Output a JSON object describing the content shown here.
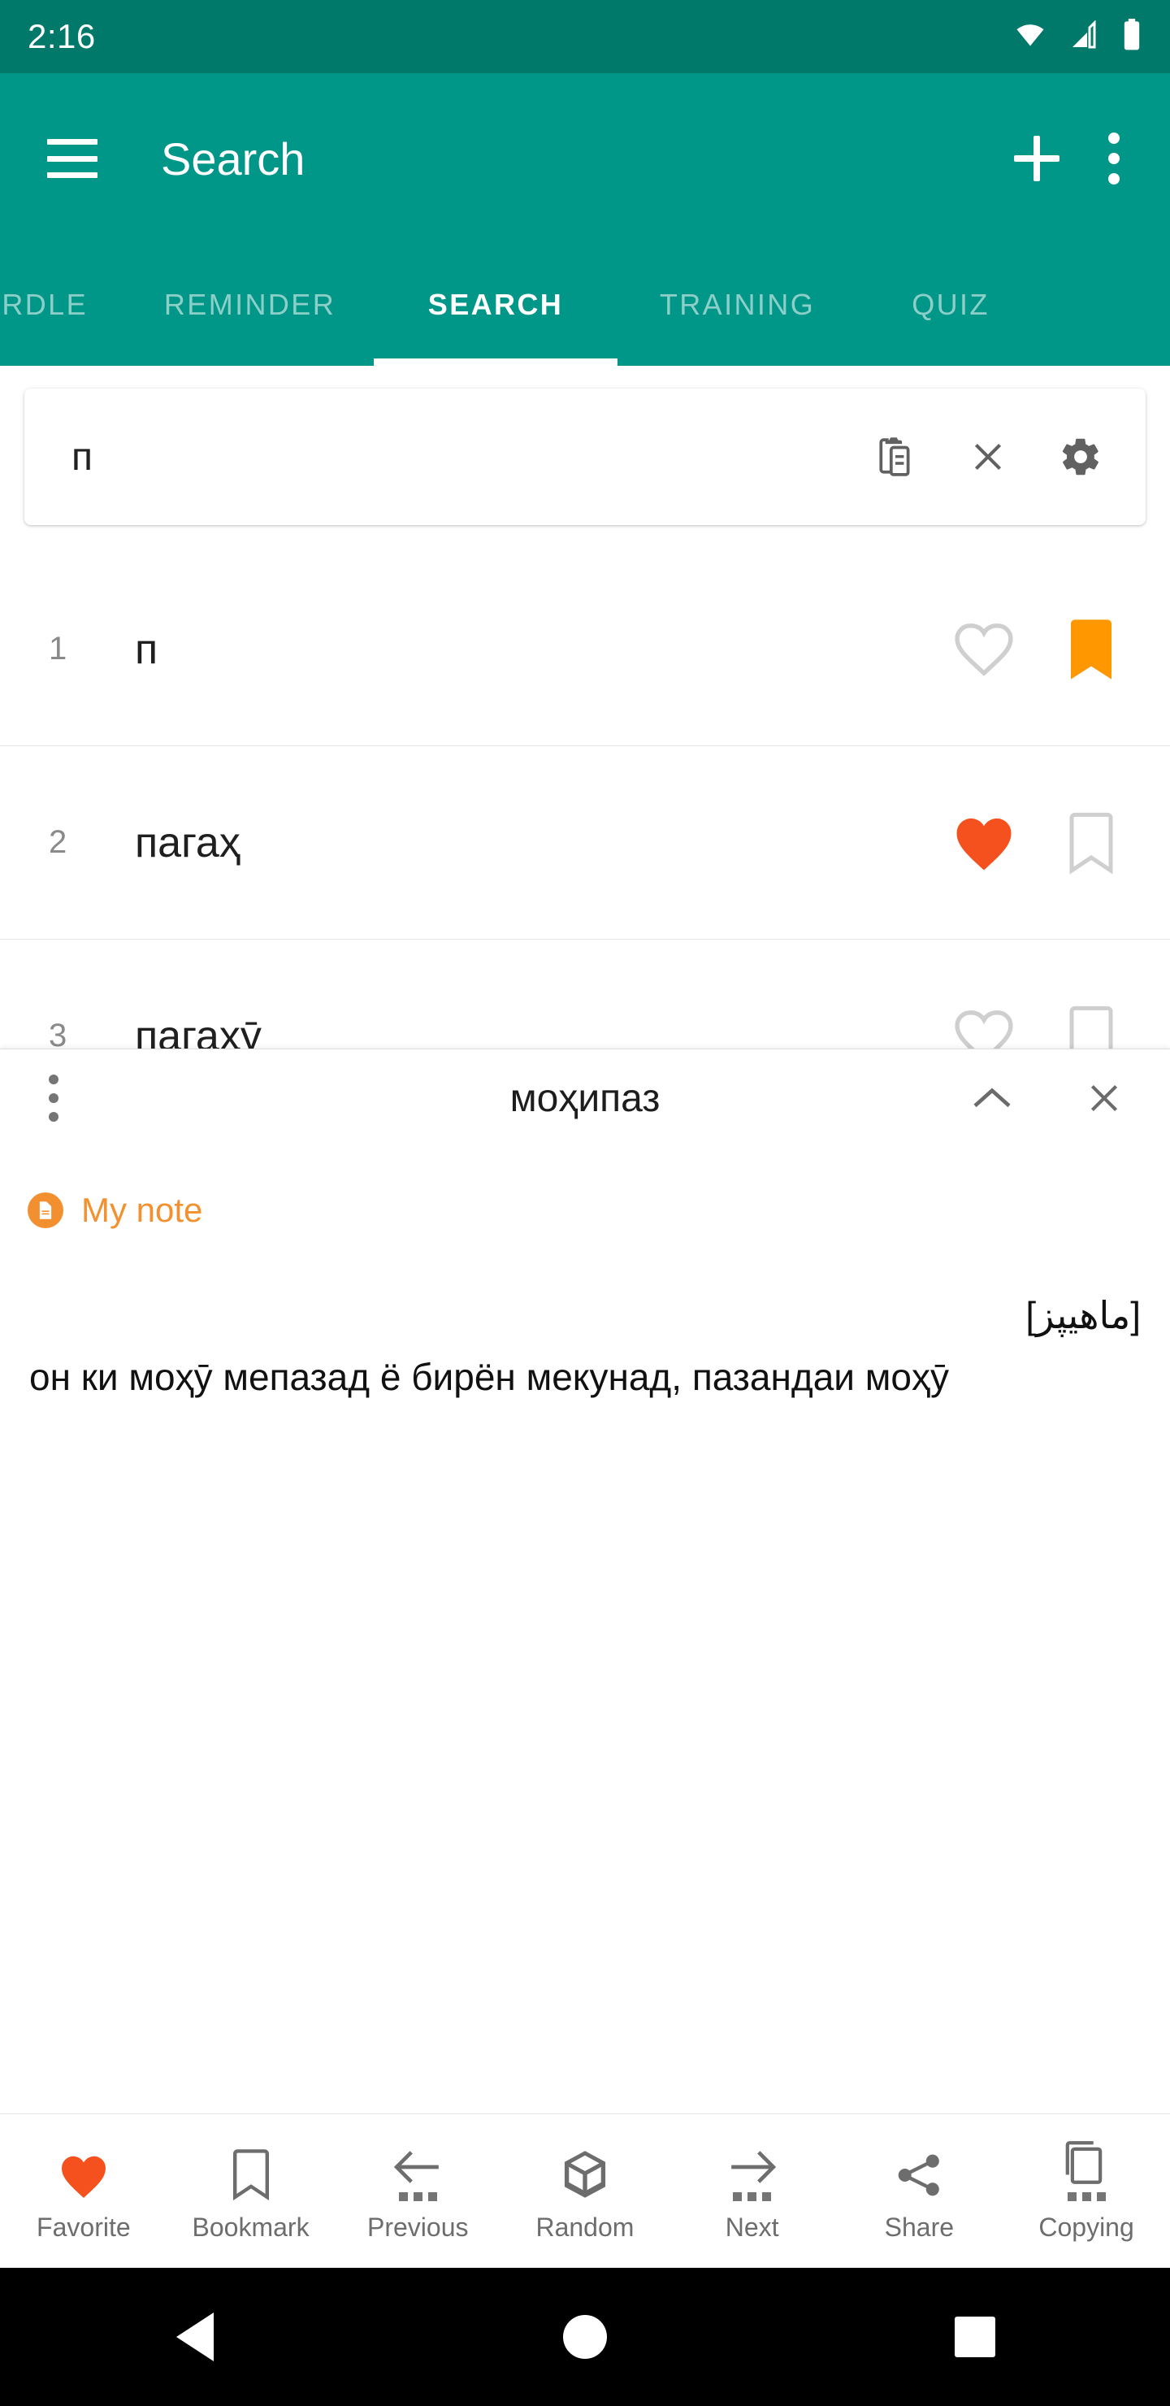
{
  "status_bar": {
    "clock": "2:16",
    "icons": [
      "wifi-icon",
      "cell-signal-icon",
      "battery-icon"
    ]
  },
  "app_bar": {
    "title": "Search",
    "menu_icon": "hamburger-icon",
    "add_icon": "plus-icon",
    "overflow_icon": "overflow-menu-icon"
  },
  "tabs": [
    {
      "label": "ORDLE",
      "active": false
    },
    {
      "label": "REMINDER",
      "active": false
    },
    {
      "label": "SEARCH",
      "active": true
    },
    {
      "label": "TRAINING",
      "active": false
    },
    {
      "label": "QUIZ",
      "active": false
    }
  ],
  "search": {
    "value": "п",
    "placeholder": "",
    "paste_icon": "clipboard-paste-icon",
    "clear_icon": "close-icon",
    "settings_icon": "gear-icon"
  },
  "results": [
    {
      "num": "1",
      "word": "п",
      "favorite": false,
      "bookmark": true
    },
    {
      "num": "2",
      "word": "пагаҳ",
      "favorite": true,
      "bookmark": false
    },
    {
      "num": "3",
      "word": "пагаҳӯ",
      "favorite": false,
      "bookmark": false
    }
  ],
  "detail": {
    "title": "моҳипаз",
    "overflow_icon": "overflow-menu-icon",
    "collapse_icon": "chevron-up-icon",
    "close_icon": "close-icon",
    "note_label": "My note",
    "note_icon": "note-document-icon",
    "arabic_script": "[ماهيپز]",
    "definition": "он ки моҳӯ мепазад ё бирён мекунад, пазандаи моҳӯ"
  },
  "bottom_bar": [
    {
      "label": "Favorite",
      "icon": "heart-filled-icon"
    },
    {
      "label": "Bookmark",
      "icon": "bookmark-outline-icon"
    },
    {
      "label": "Previous",
      "icon": "arrow-left-icon"
    },
    {
      "label": "Random",
      "icon": "dice-icon"
    },
    {
      "label": "Next",
      "icon": "arrow-right-icon"
    },
    {
      "label": "Share",
      "icon": "share-icon"
    },
    {
      "label": "Copying",
      "icon": "copy-icon"
    }
  ],
  "nav_bar": {
    "back": "back-triangle-icon",
    "home": "home-circle-icon",
    "recents": "recents-square-icon"
  },
  "colors": {
    "status_bar": "#00796B",
    "app_bar": "#009688",
    "accent_orange": "#FF9800",
    "note_orange": "#F2912F",
    "favorite_red": "#F4511E",
    "icon_grey": "#757575",
    "outline_grey": "#CCCCCC"
  }
}
